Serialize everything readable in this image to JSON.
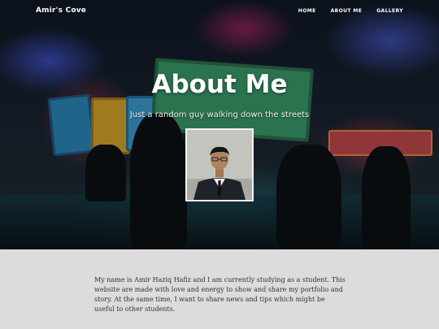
{
  "site": {
    "brand": "Amir's Cove"
  },
  "nav": {
    "items": [
      "HOME",
      "ABOUT ME",
      "GALLERY"
    ]
  },
  "hero": {
    "title": "About Me",
    "subtitle": "Just a random guy walking down the streets"
  },
  "about": {
    "paragraph": "My name is Amir Haziq Hafiz and I am currently studying as a student. This website are made with love and energy to show and share my portfolio and story. At the same time, I want to share news and tips which might be useful to other students."
  },
  "colors": {
    "about_bg": "#dcdcdc",
    "text": "#333333",
    "nav_text": "#ffffff"
  }
}
